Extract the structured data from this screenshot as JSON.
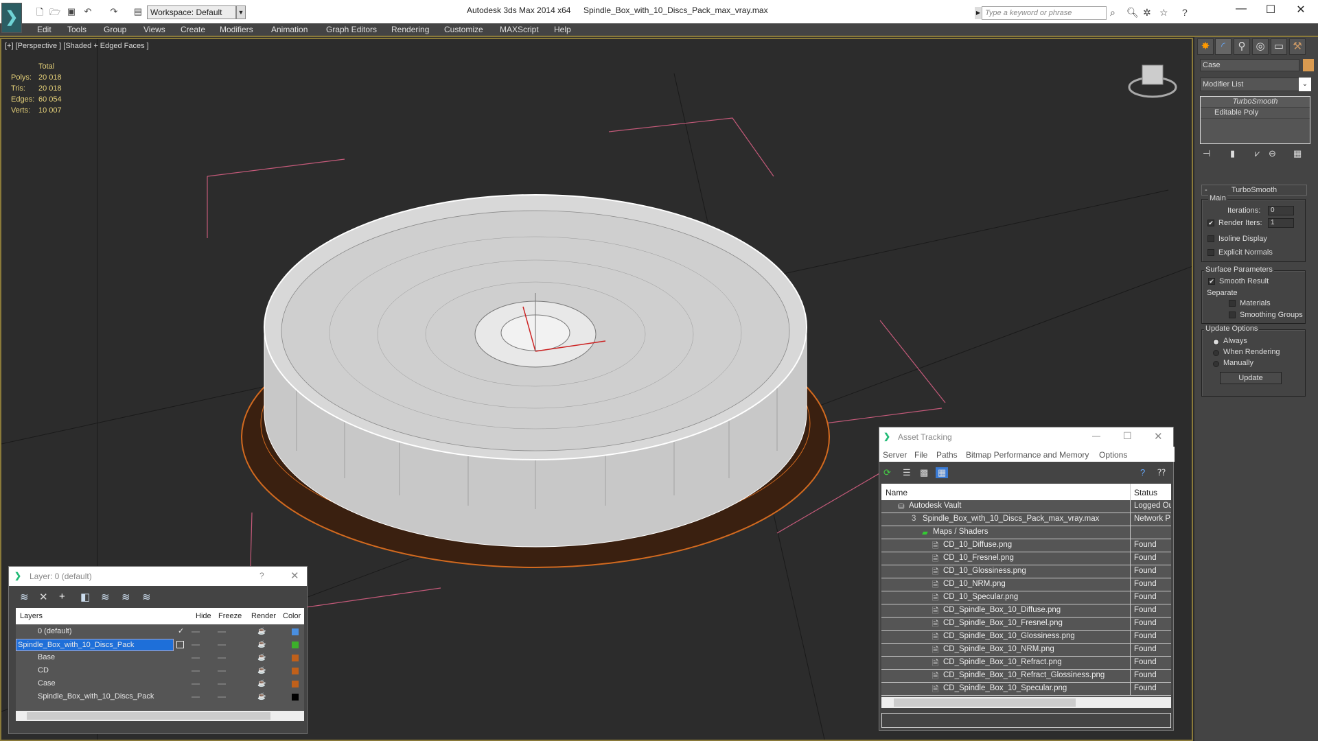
{
  "titlebar": {
    "app": "Autodesk 3ds Max  2014 x64",
    "file": "Spindle_Box_with_10_Discs_Pack_max_vray.max",
    "workspace": "Workspace: Default",
    "search_placeholder": "Type a keyword or phrase"
  },
  "menu": [
    "Edit",
    "Tools",
    "Group",
    "Views",
    "Create",
    "Modifiers",
    "Animation",
    "Graph Editors",
    "Rendering",
    "Customize",
    "MAXScript",
    "Help"
  ],
  "viewport": {
    "label": "[+] [Perspective ] [Shaded + Edged Faces ]",
    "stats": {
      "header": "Total",
      "rows": [
        {
          "label": "Polys:",
          "value": "20 018"
        },
        {
          "label": "Tris:",
          "value": "20 018"
        },
        {
          "label": "Edges:",
          "value": "60 054"
        },
        {
          "label": "Verts:",
          "value": "10 007"
        }
      ]
    }
  },
  "command_panel": {
    "object_name": "Case",
    "object_color": "#d99a50",
    "modifier_list": "Modifier List",
    "stack": [
      "TurboSmooth",
      "Editable Poly"
    ],
    "rollout": "TurboSmooth",
    "main_group": "Main",
    "iterations_label": "Iterations:",
    "iterations": "0",
    "render_iters_label": "Render Iters:",
    "render_iters": "1",
    "render_iters_checked": true,
    "isoline": "Isoline Display",
    "explicit_normals": "Explicit Normals",
    "surface_group": "Surface Parameters",
    "smooth_result": "Smooth Result",
    "separate": "Separate",
    "materials": "Materials",
    "smoothing_groups": "Smoothing Groups",
    "update_group": "Update Options",
    "always": "Always",
    "when_rendering": "When Rendering",
    "manually": "Manually",
    "update_button": "Update"
  },
  "layer_dialog": {
    "title": "Layer: 0 (default)",
    "help": "?",
    "columns": [
      "Layers",
      "Hide",
      "Freeze",
      "Render",
      "Color"
    ],
    "rows": [
      {
        "name": "0 (default)",
        "color": "#4a8fe0"
      },
      {
        "name": "Spindle_Box_with_10_Discs_Pack",
        "color": "#3cb02a"
      },
      {
        "name": "Base",
        "color": "#c0601a"
      },
      {
        "name": "CD",
        "color": "#c0601a"
      },
      {
        "name": "Case",
        "color": "#c0601a"
      },
      {
        "name": "Spindle_Box_with_10_Discs_Pack",
        "color": "#000000"
      }
    ]
  },
  "asset_dialog": {
    "title": "Asset Tracking",
    "menu": [
      "Server",
      "File",
      "Paths",
      "Bitmap Performance and Memory",
      "Options"
    ],
    "columns": [
      "Name",
      "Status"
    ],
    "rows": [
      {
        "name": "Autodesk Vault",
        "status": "Logged Ou"
      },
      {
        "name": "Spindle_Box_with_10_Discs_Pack_max_vray.max",
        "status": "Network P"
      },
      {
        "name": "Maps / Shaders",
        "status": ""
      },
      {
        "name": "CD_10_Diffuse.png",
        "status": "Found"
      },
      {
        "name": "CD_10_Fresnel.png",
        "status": "Found"
      },
      {
        "name": "CD_10_Glossiness.png",
        "status": "Found"
      },
      {
        "name": "CD_10_NRM.png",
        "status": "Found"
      },
      {
        "name": "CD_10_Specular.png",
        "status": "Found"
      },
      {
        "name": "CD_Spindle_Box_10_Diffuse.png",
        "status": "Found"
      },
      {
        "name": "CD_Spindle_Box_10_Fresnel.png",
        "status": "Found"
      },
      {
        "name": "CD_Spindle_Box_10_Glossiness.png",
        "status": "Found"
      },
      {
        "name": "CD_Spindle_Box_10_NRM.png",
        "status": "Found"
      },
      {
        "name": "CD_Spindle_Box_10_Refract.png",
        "status": "Found"
      },
      {
        "name": "CD_Spindle_Box_10_Refract_Glossiness.png",
        "status": "Found"
      },
      {
        "name": "CD_Spindle_Box_10_Specular.png",
        "status": "Found"
      }
    ]
  }
}
